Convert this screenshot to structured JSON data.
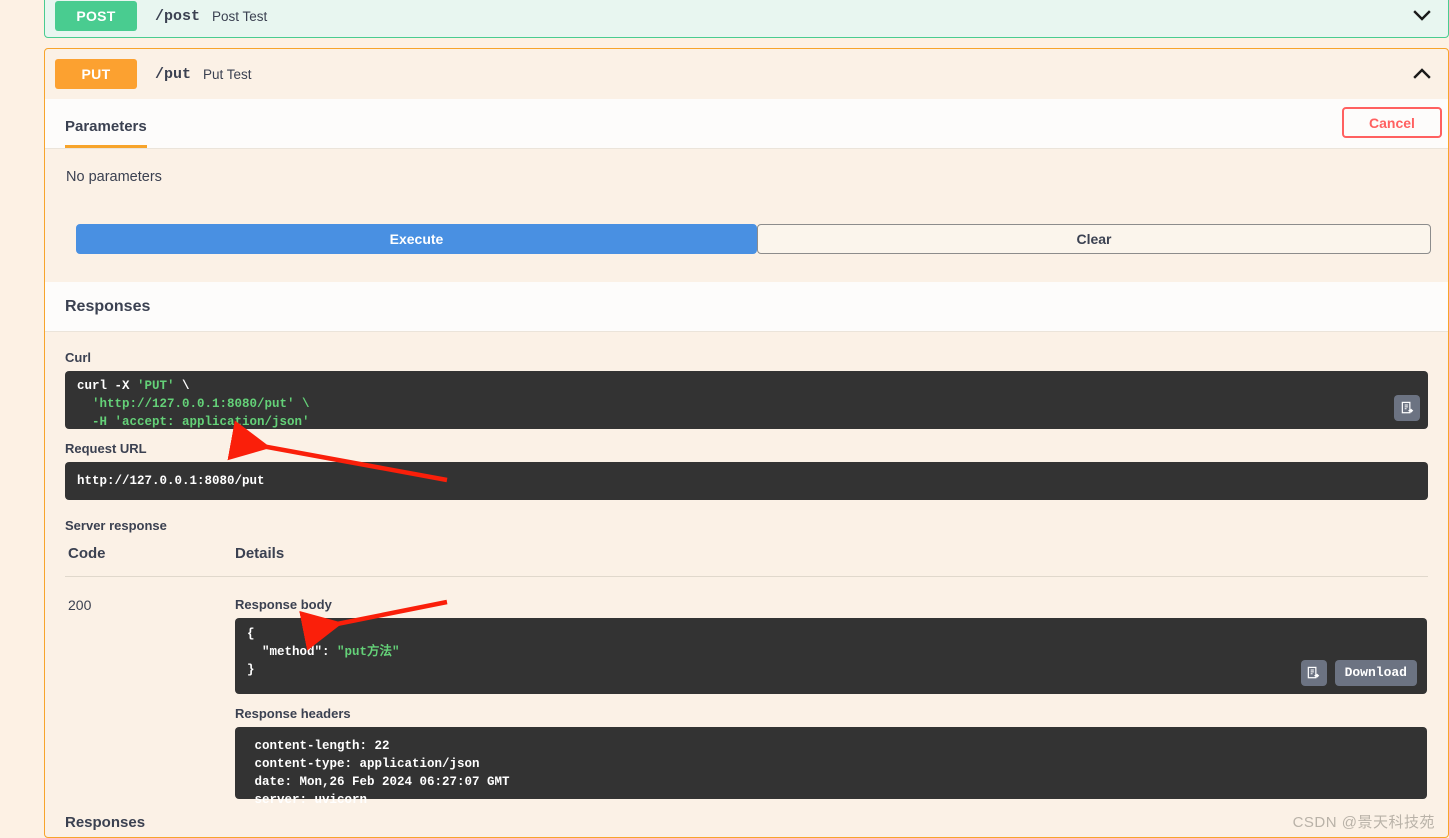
{
  "operations": [
    {
      "method": "POST",
      "path": "/post",
      "summary": "Post Test",
      "expanded": false,
      "accent": "#49cc90"
    },
    {
      "method": "PUT",
      "path": "/put",
      "summary": "Put Test",
      "expanded": true,
      "accent": "#fca130"
    }
  ],
  "tabs": {
    "parameters_label": "Parameters",
    "cancel_label": "Cancel"
  },
  "parameters": {
    "empty_text": "No parameters"
  },
  "actions": {
    "execute_label": "Execute",
    "clear_label": "Clear"
  },
  "responses_section": {
    "title": "Responses",
    "curl_label": "Curl",
    "curl": {
      "line1_cmd": "curl -X ",
      "line1_val": "'PUT'",
      "line1_tail": " \\",
      "line2": "  'http://127.0.0.1:8080/put' \\",
      "line3": "  -H 'accept: application/json'"
    },
    "request_url_label": "Request URL",
    "request_url": "http://127.0.0.1:8080/put",
    "server_response_label": "Server response",
    "table": {
      "headers": [
        "Code",
        "Details"
      ],
      "rows": [
        {
          "code": "200",
          "response_body_label": "Response body",
          "response_body": {
            "open": "{",
            "key": "  \"method\"",
            "colon": ": ",
            "value": "\"put方法\"",
            "close": "}"
          },
          "download_label": "Download",
          "response_headers_label": "Response headers",
          "response_headers": [
            " content-length: 22",
            " content-type: application/json",
            " date: Mon,26 Feb 2024 06:27:07 GMT",
            " server: uvicorn"
          ]
        }
      ]
    }
  },
  "bottom": {
    "responses_label": "Responses"
  },
  "watermark": "CSDN @景天科技苑",
  "icons": {
    "copy": "copy-to-clipboard-icon",
    "chevron_down": "chevron-down-icon",
    "chevron_up": "chevron-up-icon"
  },
  "colors": {
    "post_green": "#49cc90",
    "put_orange": "#fca130",
    "execute_blue": "#4990e2",
    "cancel_red": "#ff6060",
    "code_bg": "#333333",
    "code_green": "#64d178",
    "page_bg": "#fdf1e4"
  }
}
